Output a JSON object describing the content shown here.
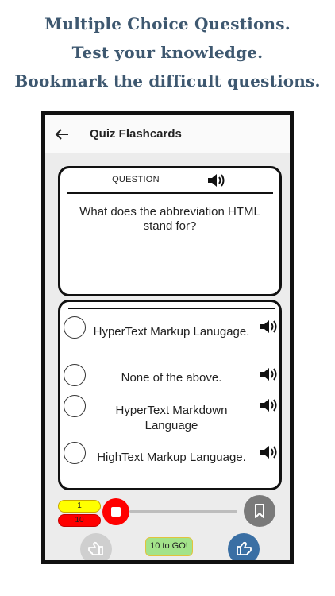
{
  "promo": {
    "line1": "Multiple Choice Questions.",
    "line2": "Test your knowledge.",
    "line3": "Bookmark the difficult questions."
  },
  "appbar": {
    "back_icon": "arrow-left-icon",
    "title": "Quiz Flashcards"
  },
  "question": {
    "label": "QUESTION",
    "speaker_icon": "speaker-icon",
    "text": "What does the abbreviation HTML stand for?"
  },
  "answers": [
    {
      "text": "HyperText Markup Lanugage."
    },
    {
      "text": "None of the above."
    },
    {
      "text": "HyperText Markdown Language"
    },
    {
      "text": "HighText Markup Language."
    }
  ],
  "progress": {
    "current": "1",
    "total": "10",
    "remaining_label": "10 to GO!"
  },
  "icons": {
    "stop": "stop-icon",
    "bookmark": "bookmark-icon",
    "previous": "thumb-left-icon",
    "next": "thumb-right-icon"
  },
  "colors": {
    "promo_text": "#3e5870",
    "stop": "#ff0000",
    "current_badge": "#ffff00",
    "total_badge": "#ff0000",
    "remaining_badge": "#a3e38a",
    "next_button": "#3a6fa4",
    "bookmark_button": "#7a7a7a"
  }
}
